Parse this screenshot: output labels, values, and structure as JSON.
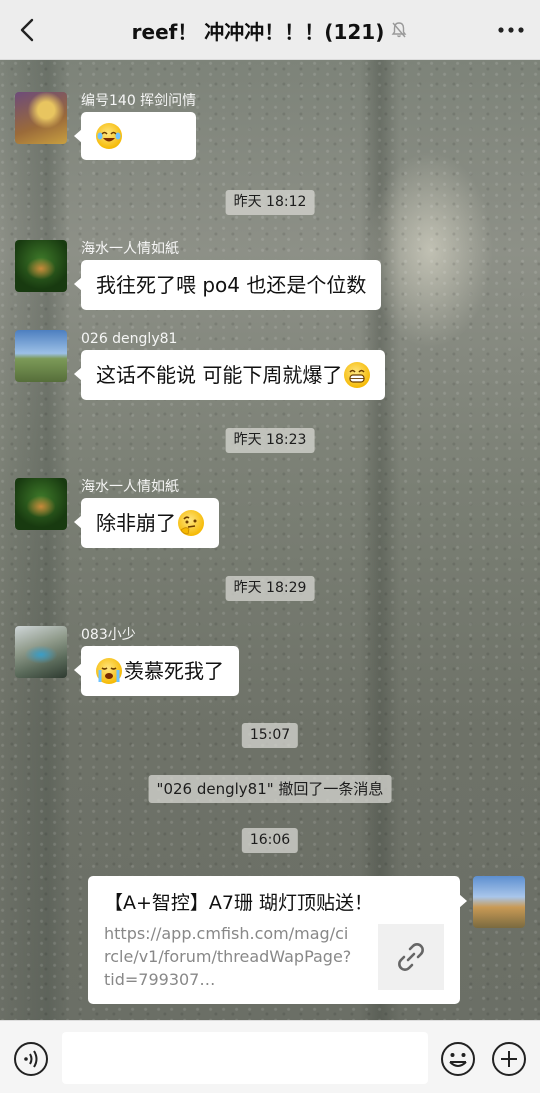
{
  "header": {
    "title": "reef！ 冲冲冲！！！(121)",
    "back_icon": "chevron-left-icon",
    "mute_icon": "bell-muted-icon",
    "more_icon": "more-dots-icon"
  },
  "messages": [
    {
      "sender": "编号140 挥剑问情",
      "text": "",
      "emoji": "laughing-tears-emoji"
    },
    {
      "time": "昨天 18:12"
    },
    {
      "sender": "海水一人情如紙",
      "text": "我往死了喂 po4 也还是个位数"
    },
    {
      "sender": "026 dengly81",
      "text": "这话不能说 可能下周就爆了",
      "emoji": "grinning-emoji"
    },
    {
      "time": "昨天 18:23"
    },
    {
      "sender": "海水一人情如紙",
      "text": "除非崩了",
      "emoji": "thinking-emoji"
    },
    {
      "time": "昨天 18:29"
    },
    {
      "sender": "083小少",
      "text": "羡慕死我了",
      "emoji": "crying-emoji"
    },
    {
      "time": "15:07"
    },
    {
      "system": "\"026 dengly81\" 撤回了一条消息"
    },
    {
      "time": "16:06"
    }
  ],
  "link_card": {
    "title": "【A+智控】A7珊 瑚灯顶贴送！",
    "url_text": "https://app.cmfish.com/mag/circle/v1/forum/threadWapPage?tid=799307…",
    "link_icon": "link-icon"
  },
  "input_bar": {
    "voice_icon": "voice-icon",
    "text_value": "",
    "emoji_icon": "smiley-icon",
    "plus_icon": "plus-circle-icon"
  }
}
